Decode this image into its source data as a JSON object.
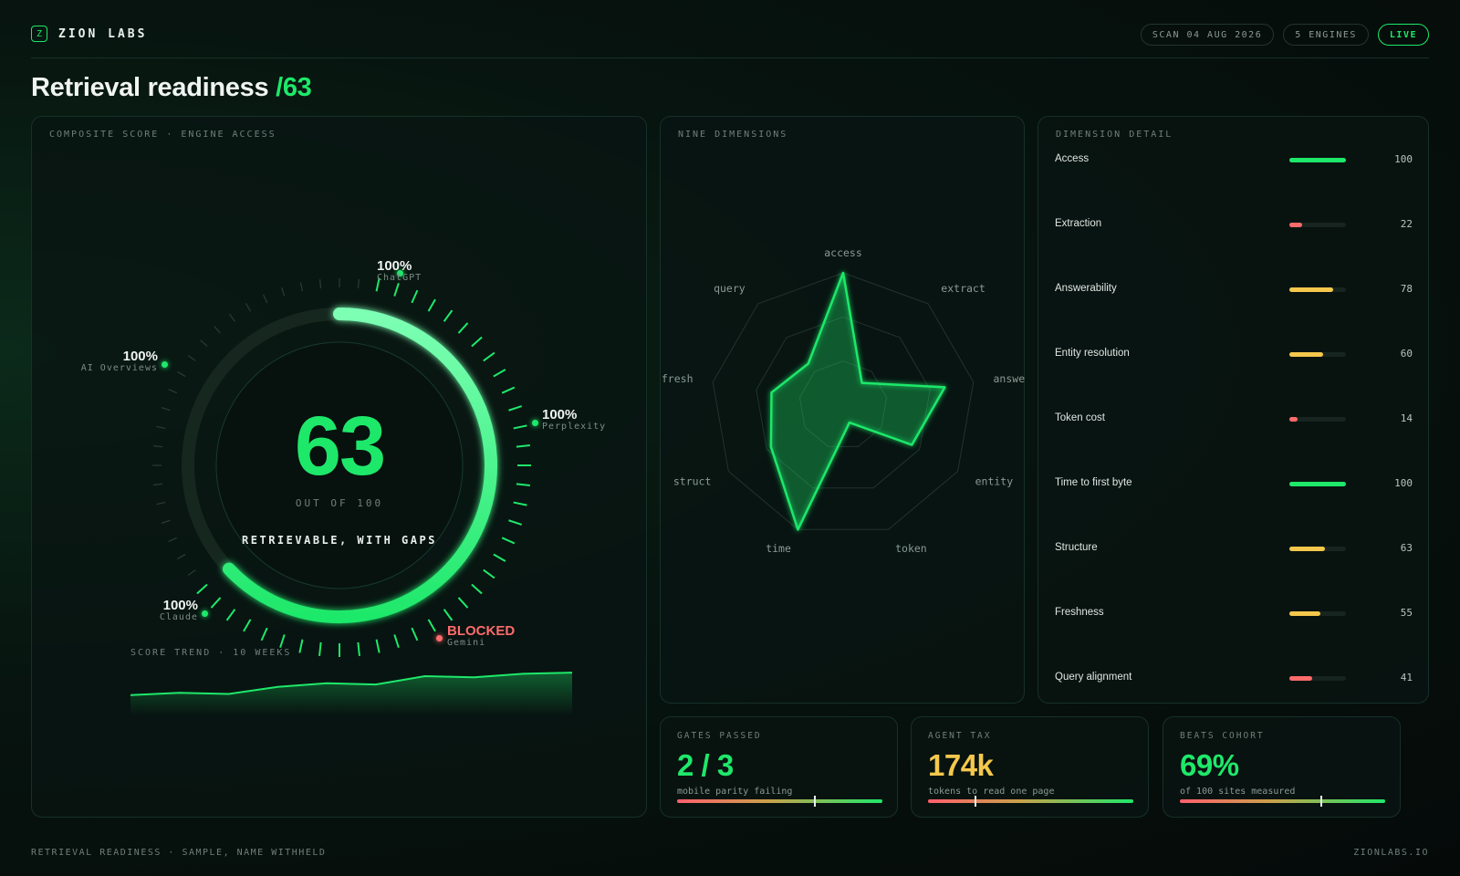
{
  "brand": {
    "logo_glyph": "Z",
    "name": "ZION LABS"
  },
  "header": {
    "pills": [
      "SCAN 04 AUG 2026",
      "5 ENGINES"
    ],
    "live_label": "LIVE"
  },
  "title": {
    "text": "Retrieval readiness",
    "separator": "/",
    "score": "63"
  },
  "composite": {
    "label": "COMPOSITE SCORE · ENGINE ACCESS",
    "score": "63",
    "score_value": 63,
    "out_of": "OUT OF 100",
    "verdict": "RETRIEVABLE, WITH GAPS",
    "engines": [
      {
        "name": "ChatGPT",
        "value": "100%"
      },
      {
        "name": "Perplexity",
        "value": "100%"
      },
      {
        "name": "AI Overviews",
        "value": "100%"
      },
      {
        "name": "Claude",
        "value": "100%"
      },
      {
        "name": "Gemini",
        "value": "BLOCKED"
      }
    ],
    "trend_label": "SCORE TREND · 10 WEEKS"
  },
  "radar": {
    "label": "NINE DIMENSIONS",
    "axes": [
      "access",
      "extract",
      "answer",
      "entity",
      "token",
      "time",
      "struct",
      "fresh",
      "query"
    ]
  },
  "detail": {
    "label": "DIMENSION DETAIL",
    "rows": [
      {
        "name": "Access",
        "value": "100"
      },
      {
        "name": "Extraction",
        "value": "22"
      },
      {
        "name": "Answerability",
        "value": "78"
      },
      {
        "name": "Entity resolution",
        "value": "60"
      },
      {
        "name": "Token cost",
        "value": "14"
      },
      {
        "name": "Time to first byte",
        "value": "100"
      },
      {
        "name": "Structure",
        "value": "63"
      },
      {
        "name": "Freshness",
        "value": "55"
      },
      {
        "name": "Query alignment",
        "value": "41"
      }
    ]
  },
  "stats": {
    "gates": {
      "label": "GATES PASSED",
      "value": "2 / 3",
      "note": "mobile parity failing",
      "marker": 0.67
    },
    "tax": {
      "label": "AGENT TAX",
      "value": "174k",
      "note": "tokens to read one page",
      "marker": 0.23
    },
    "cohort": {
      "label": "BEATS COHORT",
      "value": "69%",
      "note": "of 100 sites measured",
      "marker": 0.69
    }
  },
  "footer": {
    "left": "RETRIEVAL READINESS · SAMPLE, NAME WITHHELD",
    "right": "ZIONLABS.IO"
  },
  "colors": {
    "accent": "#1ee86a",
    "warning": "#f5c84c",
    "danger": "#ff6b6b"
  },
  "chart_data": [
    {
      "type": "line",
      "x": [
        1,
        2,
        3,
        4,
        5,
        6,
        7,
        8,
        9,
        10
      ],
      "values": [
        44,
        46,
        45,
        51,
        54,
        53,
        60,
        59,
        62,
        63
      ],
      "xlabel": "",
      "ylabel": "",
      "ylim": [
        30,
        70
      ]
    },
    {
      "type": "radar",
      "categories": [
        "access",
        "extract",
        "answer",
        "entity",
        "token",
        "time",
        "struct",
        "fresh",
        "query"
      ],
      "values": [
        100,
        22,
        78,
        60,
        14,
        100,
        63,
        55,
        41
      ],
      "ylim": [
        0,
        100
      ]
    }
  ]
}
